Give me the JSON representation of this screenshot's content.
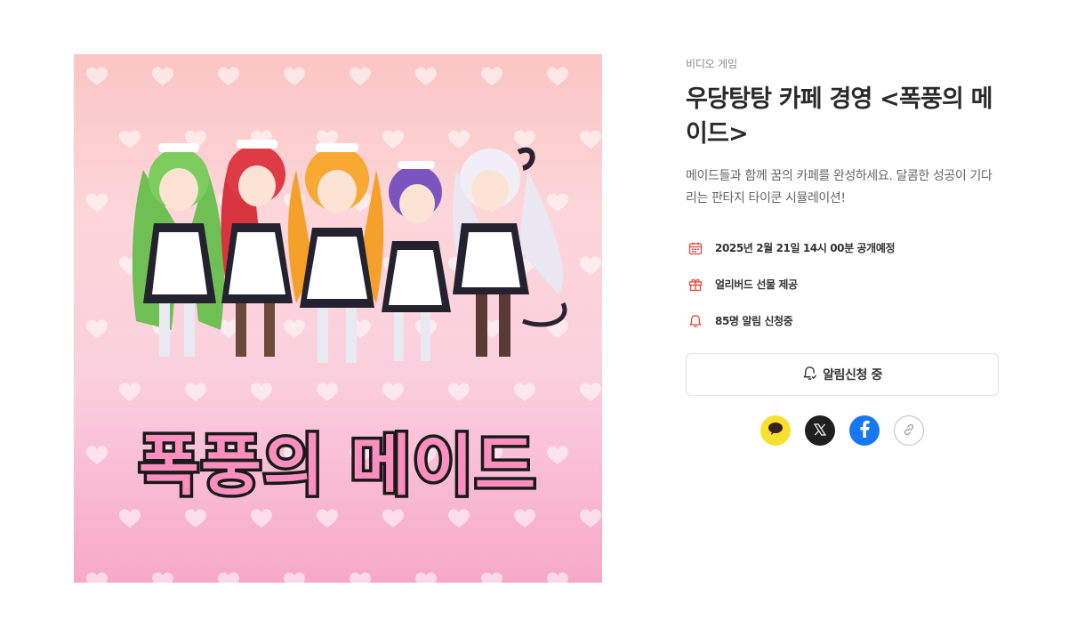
{
  "cover": {
    "logo_text": "폭풍의 메이드"
  },
  "info": {
    "category": "비디오 게임",
    "title": "우당탕탕 카페 경영 <폭풍의 메이드>",
    "description": "메이드들과 함께 꿈의 카페를 완성하세요. 달콤한 성공이 기다리는 판타지 타이쿤 시뮬레이션!",
    "meta": [
      {
        "icon": "calendar-icon",
        "text": "2025년 2월 21일 14시 00분 공개예정"
      },
      {
        "icon": "gift-icon",
        "text": "얼리버드 선물 제공"
      },
      {
        "icon": "bell-icon",
        "text": "85명 알림 신청중"
      }
    ],
    "notify_button": "알림신청 중",
    "accent_color": "#e5493f"
  },
  "share": {
    "icons": [
      "kakaotalk-icon",
      "x-icon",
      "facebook-icon",
      "link-icon"
    ]
  }
}
